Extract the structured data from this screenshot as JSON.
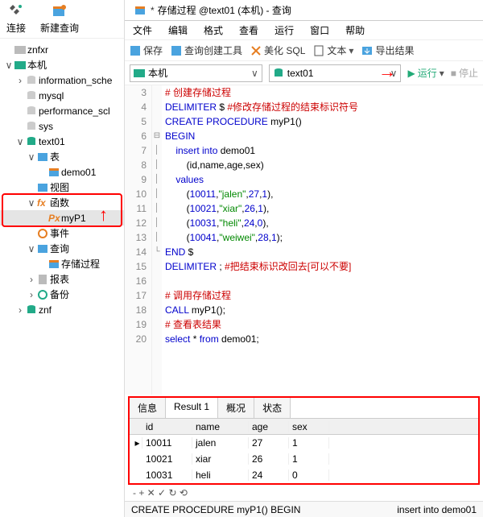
{
  "sidebar": {
    "tools": [
      {
        "label": "连接",
        "icon": "plug-icon"
      },
      {
        "label": "新建查询",
        "icon": "new-query-icon"
      }
    ],
    "tree": {
      "znfxr": "znfxr",
      "local": "本机",
      "information_schema": "information_sche",
      "mysql": "mysql",
      "performance_schema": "performance_scl",
      "sys": "sys",
      "text01": "text01",
      "tables": "表",
      "demo01": "demo01",
      "views": "视图",
      "functions": "函数",
      "myP1": "myP1",
      "events": "事件",
      "queries": "查询",
      "stored_proc_q": "存储过程",
      "reports": "报表",
      "backups": "备份",
      "znf": "znf"
    }
  },
  "tab": {
    "title": "存储过程 @text01 (本机) - 查询"
  },
  "menu": [
    "文件",
    "编辑",
    "格式",
    "查看",
    "运行",
    "窗口",
    "帮助"
  ],
  "toolbar": {
    "save": "保存",
    "query_builder": "查询创建工具",
    "beautify": "美化 SQL",
    "text": "文本",
    "export": "导出结果"
  },
  "combo": {
    "host": "本机",
    "db": "text01",
    "run": "运行",
    "stop": "停止"
  },
  "code": {
    "l3": "# 创建存储过程",
    "l4a": "DELIMITER ",
    "l4b": "$ ",
    "l4c": "#修改存储过程的结束标识符号",
    "l5": "CREATE PROCEDURE myP1()",
    "l6": "BEGIN",
    "l7": "    insert into demo01",
    "l8": "        (id,name,age,sex)",
    "l9": "    values",
    "l10": "        (10011,\"jalen\",27,1),",
    "l11": "        (10021,\"xiar\",26,1),",
    "l12": "        (10031,\"heli\",24,0),",
    "l13": "        (10041,\"weiwei\",28,1);",
    "l14": "END $",
    "l15a": "DELIMITER ",
    "l15b": "; ",
    "l15c": "#把结束标识改回去[可以不要]",
    "l17": "# 调用存储过程",
    "l18": "CALL myP1();",
    "l19": "# 查看表结果",
    "l20a": "select ",
    "l20b": "* ",
    "l20c": "from ",
    "l20d": "demo01;"
  },
  "result": {
    "tabs": [
      "信息",
      "Result 1",
      "概况",
      "状态"
    ],
    "cols": [
      "id",
      "name",
      "age",
      "sex"
    ],
    "rows": [
      {
        "id": "10011",
        "name": "jalen",
        "age": "27",
        "sex": "1"
      },
      {
        "id": "10021",
        "name": "xiar",
        "age": "26",
        "sex": "1"
      },
      {
        "id": "10031",
        "name": "heli",
        "age": "24",
        "sex": "0"
      }
    ]
  },
  "status": {
    "left": "CREATE PROCEDURE myP1() BEGIN",
    "right": "insert into demo01"
  },
  "nav_icons": "- + ✕ ✓ ↻ ⟲"
}
